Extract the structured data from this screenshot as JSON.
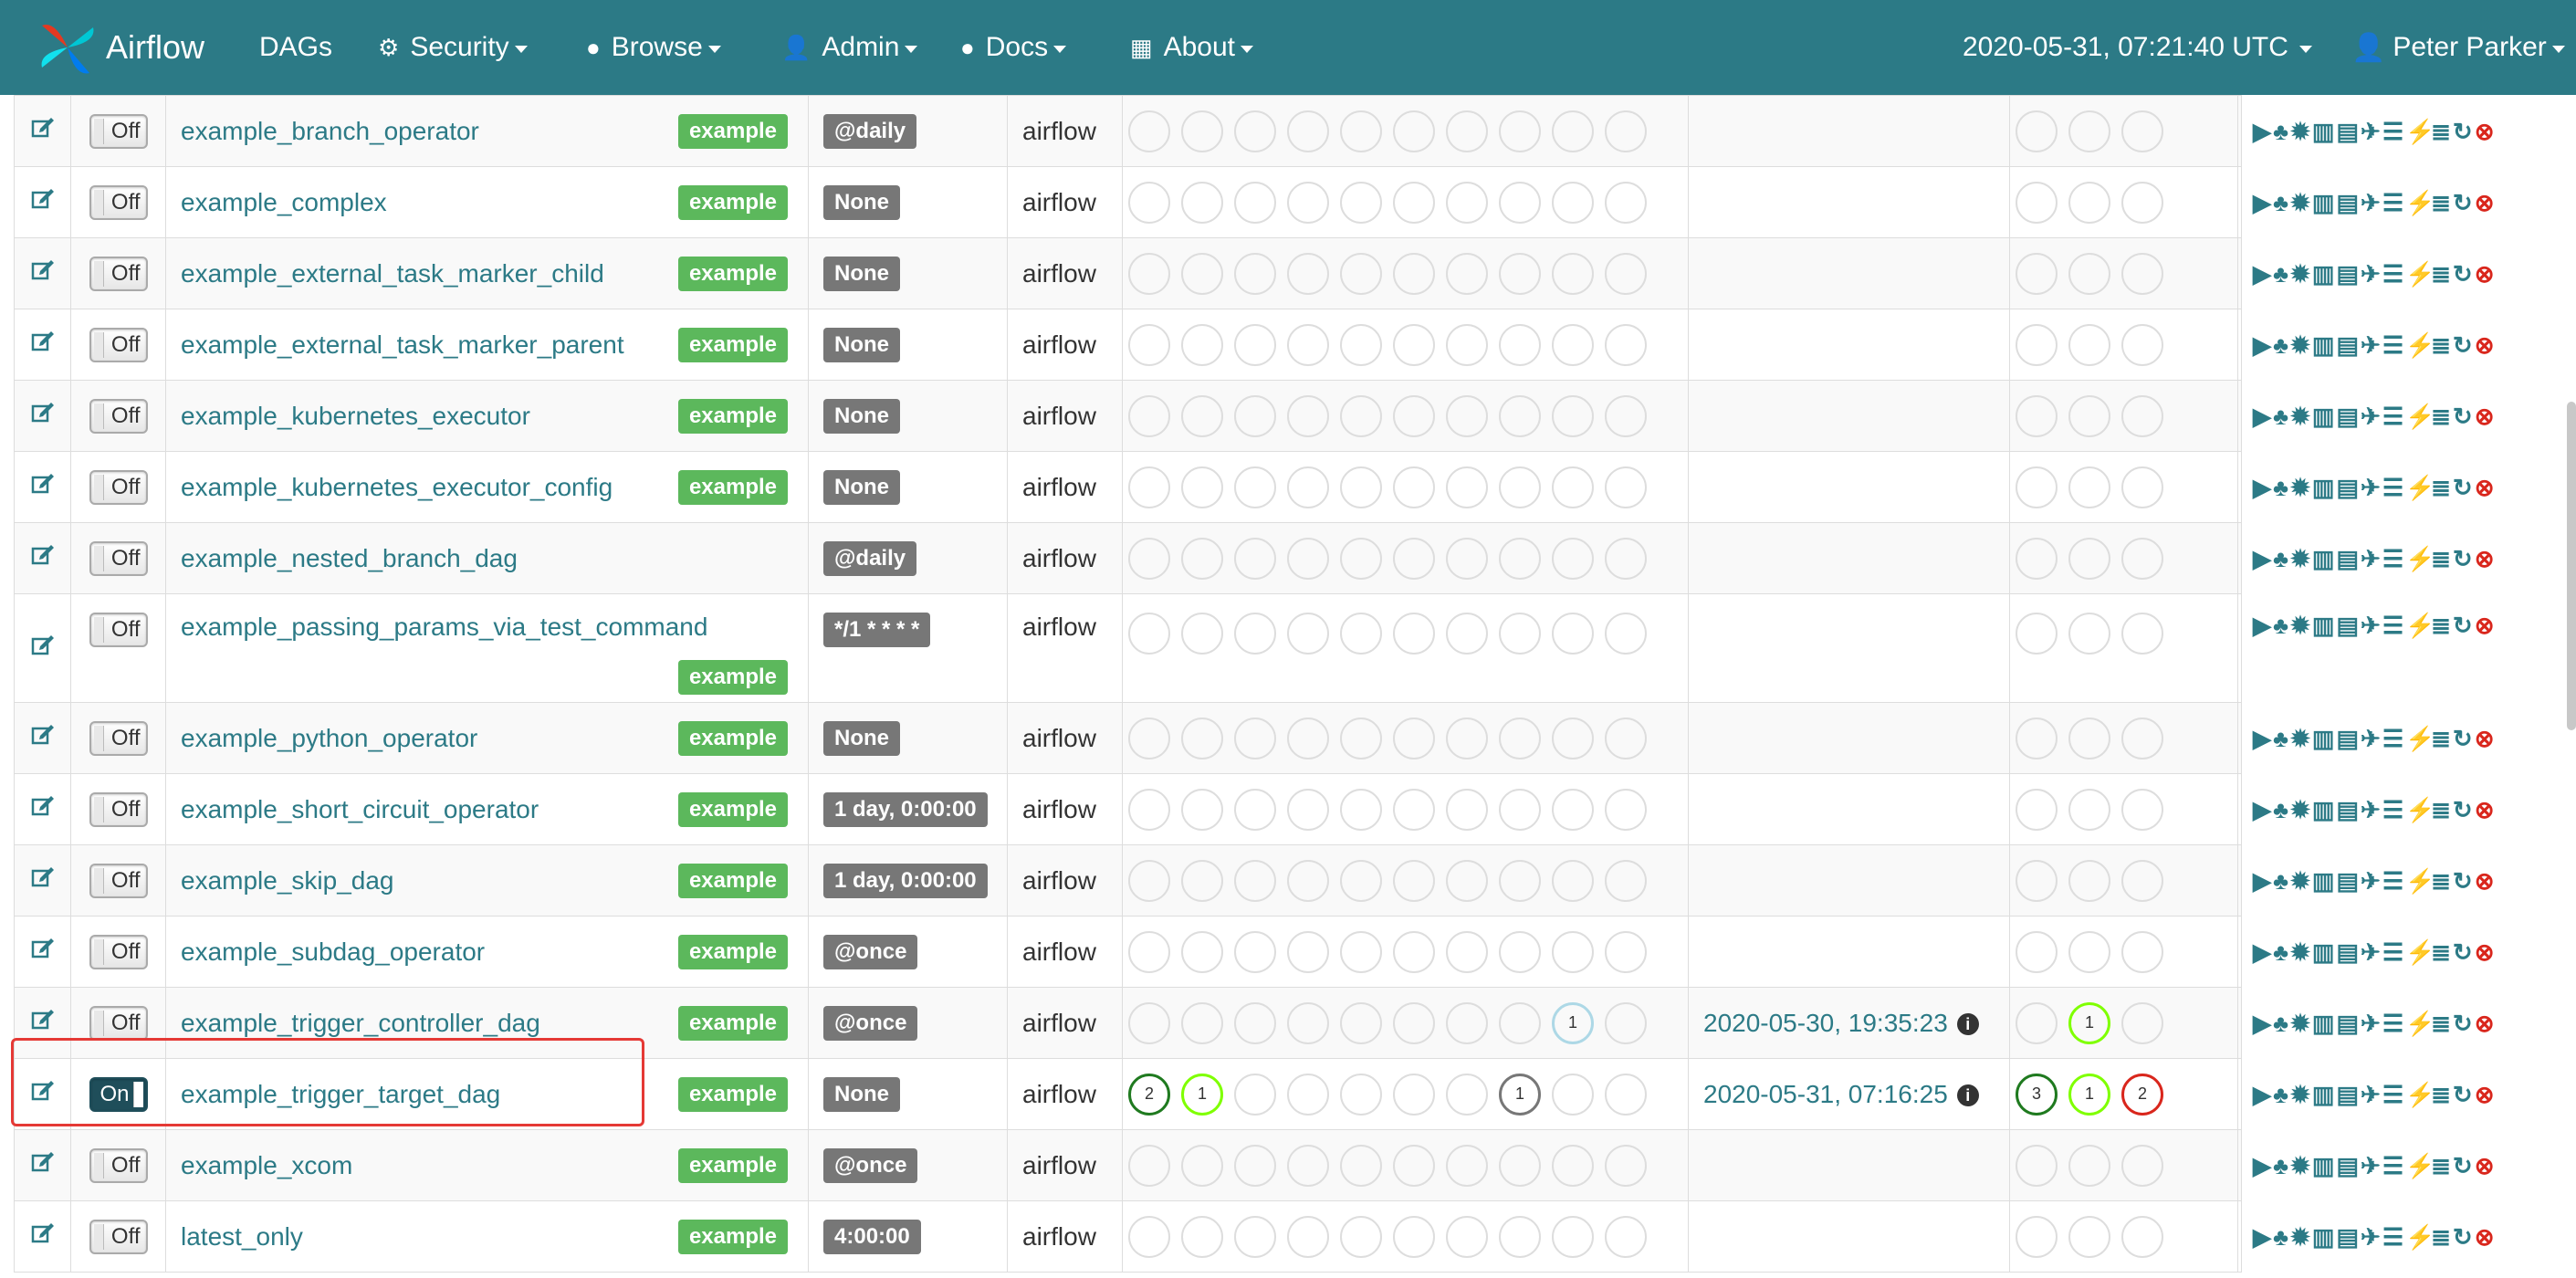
{
  "nav": {
    "brand": "Airflow",
    "dags": "DAGs",
    "security": "Security",
    "browse": "Browse",
    "admin": "Admin",
    "docs": "Docs",
    "about": "About",
    "datetime": "2020-05-31, 07:21:40 UTC",
    "user": "Peter Parker"
  },
  "rows": [
    {
      "name": "example_branch_operator",
      "tag": "example",
      "schedule": "@daily",
      "owner": "airflow",
      "toggle": "Off",
      "last_run": "",
      "runs": [],
      "tasks": []
    },
    {
      "name": "example_complex",
      "tag": "example",
      "schedule": "None",
      "owner": "airflow",
      "toggle": "Off",
      "last_run": "",
      "runs": [],
      "tasks": []
    },
    {
      "name": "example_external_task_marker_child",
      "tag": "example",
      "schedule": "None",
      "owner": "airflow",
      "toggle": "Off",
      "last_run": "",
      "runs": [],
      "tasks": []
    },
    {
      "name": "example_external_task_marker_parent",
      "tag": "example",
      "schedule": "None",
      "owner": "airflow",
      "toggle": "Off",
      "last_run": "",
      "runs": [],
      "tasks": []
    },
    {
      "name": "example_kubernetes_executor",
      "tag": "example",
      "schedule": "None",
      "owner": "airflow",
      "toggle": "Off",
      "last_run": "",
      "runs": [],
      "tasks": []
    },
    {
      "name": "example_kubernetes_executor_config",
      "tag": "example",
      "schedule": "None",
      "owner": "airflow",
      "toggle": "Off",
      "last_run": "",
      "runs": [],
      "tasks": []
    },
    {
      "name": "example_nested_branch_dag",
      "tag": "",
      "schedule": "@daily",
      "owner": "airflow",
      "toggle": "Off",
      "last_run": "",
      "runs": [],
      "tasks": []
    },
    {
      "name": "example_passing_params_via_test_command",
      "tag": "example",
      "schedule": "*/1 * * * *",
      "owner": "airflow",
      "toggle": "Off",
      "last_run": "",
      "runs": [],
      "tasks": []
    },
    {
      "name": "example_python_operator",
      "tag": "example",
      "schedule": "None",
      "owner": "airflow",
      "toggle": "Off",
      "last_run": "",
      "runs": [],
      "tasks": []
    },
    {
      "name": "example_short_circuit_operator",
      "tag": "example",
      "schedule": "1 day, 0:00:00",
      "owner": "airflow",
      "toggle": "Off",
      "last_run": "",
      "runs": [],
      "tasks": []
    },
    {
      "name": "example_skip_dag",
      "tag": "example",
      "schedule": "1 day, 0:00:00",
      "owner": "airflow",
      "toggle": "Off",
      "last_run": "",
      "runs": [],
      "tasks": []
    },
    {
      "name": "example_subdag_operator",
      "tag": "example",
      "schedule": "@once",
      "owner": "airflow",
      "toggle": "Off",
      "last_run": "",
      "runs": [],
      "tasks": []
    },
    {
      "name": "example_trigger_controller_dag",
      "tag": "example",
      "schedule": "@once",
      "owner": "airflow",
      "toggle": "Off",
      "last_run": "2020-05-30, 19:35:23",
      "runs": [
        {
          "i": 8,
          "n": "1",
          "s": "lightblue"
        }
      ],
      "tasks": [
        {
          "i": 1,
          "n": "1",
          "s": "running"
        }
      ]
    },
    {
      "name": "example_trigger_target_dag",
      "tag": "example",
      "schedule": "None",
      "owner": "airflow",
      "toggle": "On",
      "last_run": "2020-05-31, 07:16:25",
      "runs": [
        {
          "i": 0,
          "n": "2",
          "s": "success"
        },
        {
          "i": 1,
          "n": "1",
          "s": "running"
        },
        {
          "i": 7,
          "n": "1",
          "s": "queued"
        }
      ],
      "tasks": [
        {
          "i": 0,
          "n": "3",
          "s": "success"
        },
        {
          "i": 1,
          "n": "1",
          "s": "running"
        },
        {
          "i": 2,
          "n": "2",
          "s": "failed"
        }
      ]
    },
    {
      "name": "example_xcom",
      "tag": "example",
      "schedule": "@once",
      "owner": "airflow",
      "toggle": "Off",
      "last_run": "",
      "runs": [],
      "tasks": []
    },
    {
      "name": "latest_only",
      "tag": "example",
      "schedule": "4:00:00",
      "owner": "airflow",
      "toggle": "Off",
      "last_run": "",
      "runs": [],
      "tasks": []
    }
  ],
  "link_icons": [
    "trigger-dag-icon",
    "tree-view-icon",
    "graph-view-icon",
    "duration-icon",
    "retries-icon",
    "landing-times-icon",
    "gantt-icon",
    "code-view-icon",
    "logs-icon",
    "refresh-icon",
    "delete-icon"
  ]
}
